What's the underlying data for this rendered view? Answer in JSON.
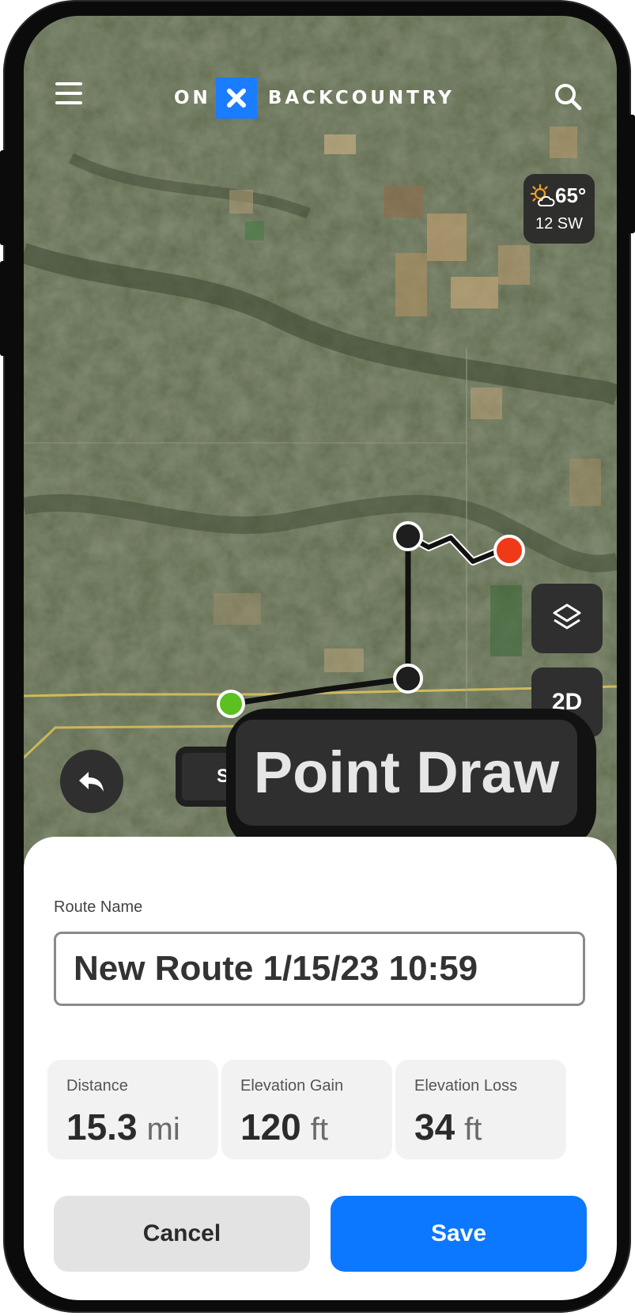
{
  "header": {
    "logo_left": "ON",
    "logo_mark": "×",
    "logo_right": "BACKCOUNTRY",
    "menu_icon": "hamburger-menu-icon",
    "search_icon": "search-icon"
  },
  "weather": {
    "icon": "partly-sunny-icon",
    "temperature": "65°",
    "wind": "12 SW"
  },
  "map": {
    "layers_icon": "layers-icon",
    "view_mode_label": "2D",
    "undo_icon": "undo-icon",
    "snap_label": "S",
    "draw_mode_label": "Point Draw",
    "route_color": "#111111",
    "end_marker_color": "#f03a17",
    "start_marker_color": "#5cc020"
  },
  "sheet": {
    "route_name_label": "Route Name",
    "route_name_value": "New Route 1/15/23 10:59",
    "stats": [
      {
        "label": "Distance",
        "value": "15.3",
        "unit": "mi"
      },
      {
        "label": "Elevation Gain",
        "value": "120",
        "unit": "ft"
      },
      {
        "label": "Elevation Loss",
        "value": "34",
        "unit": "ft"
      }
    ],
    "cancel_label": "Cancel",
    "save_label": "Save",
    "save_color": "#0b78ff"
  }
}
